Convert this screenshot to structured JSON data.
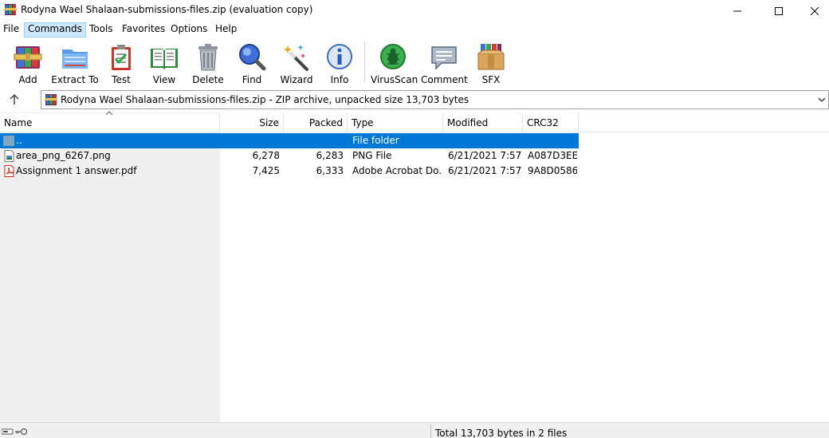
{
  "window": {
    "title": "Rodyna Wael Shalaan-submissions-files.zip (evaluation copy)",
    "controls": {
      "minimize": "minimize",
      "maximize": "maximize",
      "close": "close"
    }
  },
  "menu": {
    "items": [
      {
        "label": "File",
        "active": false
      },
      {
        "label": "Commands",
        "active": true
      },
      {
        "label": "Tools",
        "active": false
      },
      {
        "label": "Favorites",
        "active": false
      },
      {
        "label": "Options",
        "active": false
      },
      {
        "label": "Help",
        "active": false
      }
    ]
  },
  "toolbar": {
    "tools": [
      {
        "label": "Add",
        "icon": "add-archive-icon"
      },
      {
        "label": "Extract To",
        "icon": "extract-folder-icon"
      },
      {
        "label": "Test",
        "icon": "test-clipboard-icon"
      },
      {
        "label": "View",
        "icon": "view-book-icon"
      },
      {
        "label": "Delete",
        "icon": "trash-bin-icon"
      },
      {
        "label": "Find",
        "icon": "magnifier-icon"
      },
      {
        "label": "Wizard",
        "icon": "magic-wand-icon"
      },
      {
        "label": "Info",
        "icon": "info-icon"
      },
      {
        "label": "VirusScan",
        "icon": "bug-scan-icon"
      },
      {
        "label": "Comment",
        "icon": "comment-bubble-icon"
      },
      {
        "label": "SFX",
        "icon": "sfx-box-icon"
      }
    ]
  },
  "address": {
    "text": "Rodyna Wael Shalaan-submissions-files.zip - ZIP archive, unpacked size 13,703 bytes"
  },
  "columns": {
    "name": "Name",
    "size": "Size",
    "packed": "Packed",
    "type": "Type",
    "modified": "Modified",
    "crc32": "CRC32"
  },
  "files": [
    {
      "name": "..",
      "size": "",
      "packed": "",
      "type": "File folder",
      "modified": "",
      "crc32": "",
      "icon": "parent-folder-icon",
      "selected": true
    },
    {
      "name": "area_png_6267.png",
      "size": "6,278",
      "packed": "6,283",
      "type": "PNG File",
      "modified": "6/21/2021 7:57 ...",
      "crc32": "A087D3EE",
      "icon": "png-file-icon",
      "selected": false
    },
    {
      "name": "Assignment 1 answer.pdf",
      "size": "7,425",
      "packed": "6,333",
      "type": "Adobe Acrobat Do...",
      "modified": "6/21/2021 7:57 ...",
      "crc32": "9A8D0586",
      "icon": "pdf-file-icon",
      "selected": false
    }
  ],
  "status": {
    "total": "Total 13,703 bytes in 2 files"
  },
  "colors": {
    "selection": "#0078d7",
    "menu_active": "#cce8ff"
  }
}
